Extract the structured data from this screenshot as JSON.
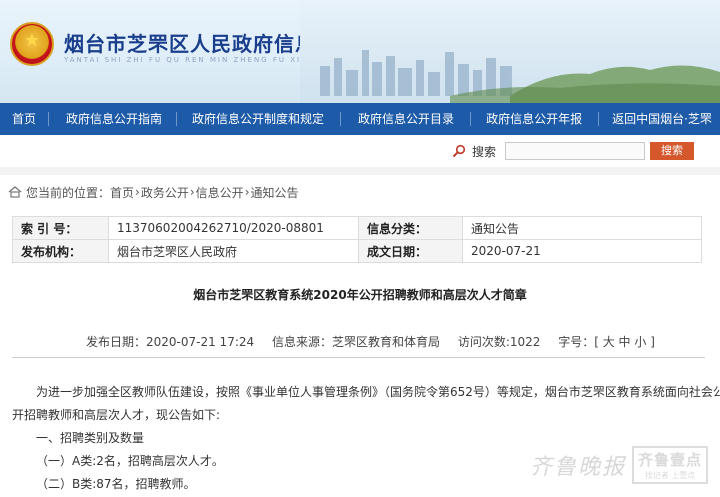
{
  "header": {
    "title": "烟台市芝罘区人民政府信息公开平台",
    "pinyin": "YANTAI SHI ZHI FU QU REN MIN ZHENG FU XIN XI GONG KAI PING TAI"
  },
  "nav": {
    "items": [
      {
        "label": "首页"
      },
      {
        "label": "政府信息公开指南"
      },
      {
        "label": "政府信息公开制度和规定"
      },
      {
        "label": "政府信息公开目录"
      },
      {
        "label": "政府信息公开年报"
      },
      {
        "label": "返回中国烟台·芝罘"
      }
    ]
  },
  "search": {
    "label": "搜索",
    "value": "",
    "button_label": "搜索"
  },
  "breadcrumb": {
    "prefix": "您当前的位置：",
    "items": [
      "首页",
      "政务公开",
      "信息公开",
      "通知公告"
    ],
    "separator": "›"
  },
  "info": {
    "index_label": "索 引 号：",
    "index_value": "11370602004262710/2020-08801",
    "category_label": "信息分类：",
    "category_value": "通知公告",
    "publisher_label": "发布机构：",
    "publisher_value": "烟台市芝罘区人民政府",
    "date_label": "成文日期：",
    "date_value": "2020-07-21"
  },
  "article": {
    "title": "烟台市芝罘区教育系统2020年公开招聘教师和高层次人才简章",
    "meta": {
      "publish_date": "发布日期：2020-07-21 17:24",
      "source": "信息来源：芝罘区教育和体育局",
      "visits": "访问次数:1022",
      "font_size_label": "字号：",
      "font_size_ctrl": "[ 大 中 小 ]"
    },
    "paragraphs": [
      "为进一步加强全区教师队伍建设，按照《事业单位人事管理条例》（国务院令第652号）等规定，烟台市芝罘区教育系统面向社会公",
      "开招聘教师和高层次人才，现公告如下:",
      "一、招聘类别及数量",
      "（一）A类:2名，招聘高层次人才。",
      "（二）B类:87名，招聘教师。"
    ]
  },
  "watermark": {
    "script": "齐鲁晚报",
    "box_title": "齐鲁壹点",
    "box_sub": "找记者·上壹点"
  },
  "colors": {
    "nav_bg": "#1d5aa8",
    "title_color": "#1a3e8c",
    "search_button": "#d4582c"
  }
}
